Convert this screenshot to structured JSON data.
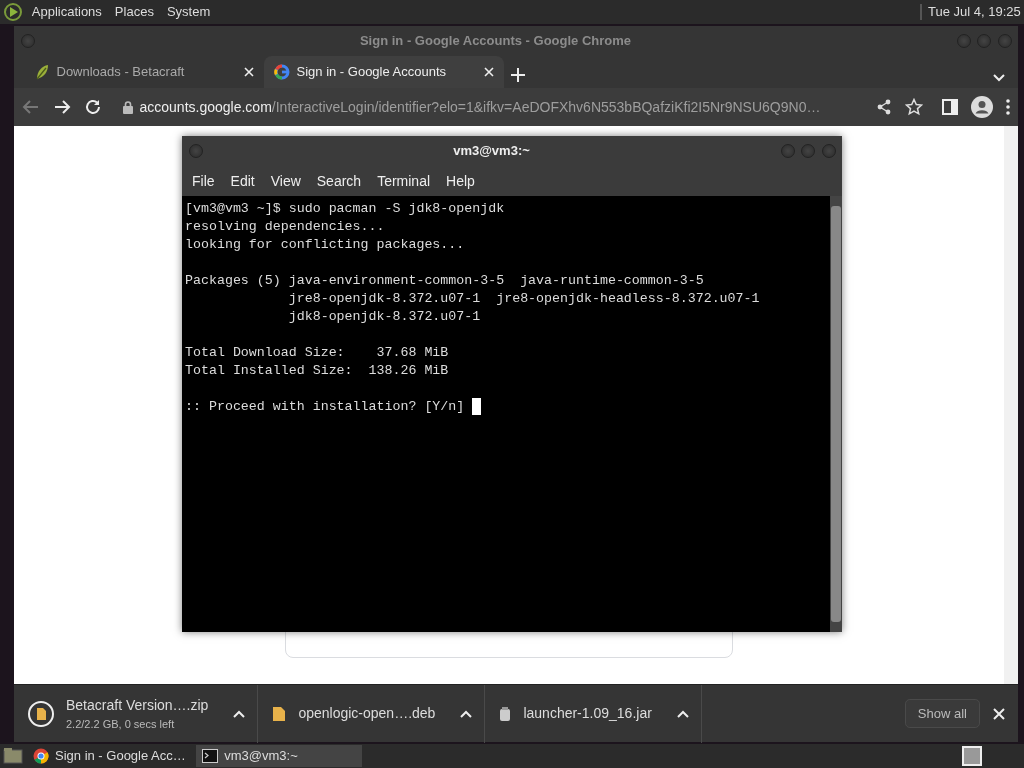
{
  "top_panel": {
    "menus": [
      "Applications",
      "Places",
      "System"
    ],
    "clock": "Tue Jul 4, 19:25"
  },
  "browser": {
    "title": "Sign in - Google Accounts - Google Chrome",
    "tabs": [
      {
        "label": "Downloads - Betacraft",
        "kind": "betacraft",
        "selected": false
      },
      {
        "label": "Sign in - Google Accounts",
        "kind": "google",
        "selected": true
      }
    ],
    "back_disabled": true,
    "url_host": "accounts.google.com",
    "url_path": "/InteractiveLogin/identifier?elo=1&ifkv=AeDOFXhv6N553bBQafziKfi2I5Nr9NSU6Q9N0…"
  },
  "terminal": {
    "title": "vm3@vm3:~",
    "menus": [
      "File",
      "Edit",
      "View",
      "Search",
      "Terminal",
      "Help"
    ],
    "blocks": [
      [
        "[vm3@vm3 ~]$ sudo pacman -S jdk8-openjdk",
        "resolving dependencies...",
        "looking for conflicting packages..."
      ],
      [
        "Packages (5) java-environment-common-3-5  java-runtime-common-3-5",
        "             jre8-openjdk-8.372.u07-1  jre8-openjdk-headless-8.372.u07-1",
        "             jdk8-openjdk-8.372.u07-1"
      ],
      [
        "Total Download Size:    37.68 MiB",
        "Total Installed Size:  138.26 MiB"
      ],
      [
        ":: Proceed with installation? [Y/n] "
      ]
    ],
    "cursor": true
  },
  "downloads": [
    {
      "name": "Betacraft Version….zip",
      "status": "2.2/2.2 GB, 0 secs left",
      "kind": "zip"
    },
    {
      "name": "openlogic-open….deb",
      "kind": "deb"
    },
    {
      "name": "launcher-1.09_16.jar",
      "kind": "jar"
    }
  ],
  "show_all": "Show all",
  "taskbar": {
    "tasks": [
      {
        "label": "Sign in - Google Acc…",
        "kind": "chrome",
        "selected": false
      },
      {
        "label": "vm3@vm3:~",
        "kind": "terminal",
        "selected": true
      }
    ]
  }
}
